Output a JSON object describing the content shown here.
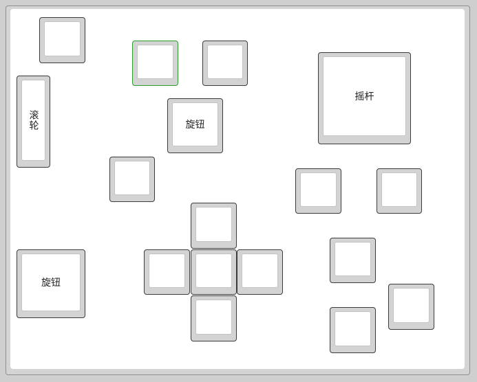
{
  "keys": {
    "scroll_wheel": {
      "label": "滚轮"
    },
    "knob_top": {
      "label": "旋钮"
    },
    "knob_bottom": {
      "label": "旋钮"
    },
    "joystick": {
      "label": "摇杆"
    }
  },
  "colors": {
    "active_key_border": "#2f9a2f",
    "key_border": "#3b3b3b",
    "key_fill": "#d3d3d3",
    "cap_fill": "#ffffff",
    "background": "#d2d2d2"
  }
}
